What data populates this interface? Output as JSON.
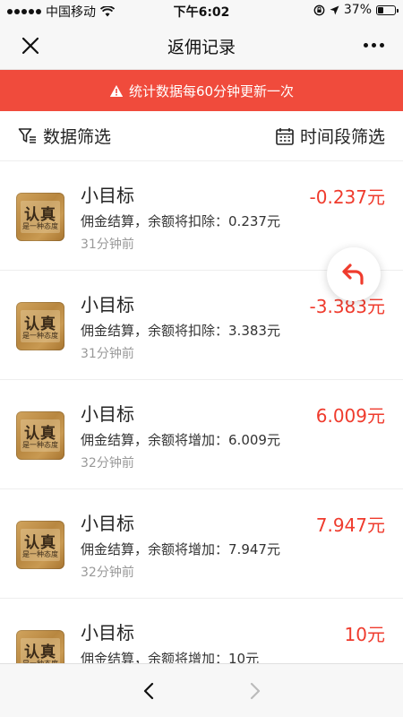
{
  "status_bar": {
    "carrier": "中国移动",
    "time": "下午6:02",
    "battery": "37%",
    "battery_level": 0.37
  },
  "nav": {
    "title": "返佣记录"
  },
  "notice": {
    "text": "统计数据每60分钟更新一次",
    "color": "#f04b3c"
  },
  "filters": {
    "data_filter": "数据筛选",
    "time_filter": "时间段筛选"
  },
  "thumbnail": {
    "line1": "认真",
    "line2": "是一种态度"
  },
  "records": [
    {
      "name": "小目标",
      "desc": "佣金结算，余额将扣除：0.237元",
      "time": "31分钟前",
      "amount": "-0.237元"
    },
    {
      "name": "小目标",
      "desc": "佣金结算，余额将扣除：3.383元",
      "time": "31分钟前",
      "amount": "-3.383元"
    },
    {
      "name": "小目标",
      "desc": "佣金结算，余额将增加：6.009元",
      "time": "32分钟前",
      "amount": "6.009元"
    },
    {
      "name": "小目标",
      "desc": "佣金结算，余额将增加：7.947元",
      "time": "32分钟前",
      "amount": "7.947元"
    },
    {
      "name": "小目标",
      "desc": "佣金结算，余额将增加：10元",
      "time": "",
      "amount": "10元"
    }
  ],
  "colors": {
    "accent_red": "#ef3b2d"
  },
  "icons": {
    "back_float": "undo-arrow-icon",
    "bottom_back": "chevron-left-icon",
    "bottom_forward": "chevron-right-icon"
  }
}
